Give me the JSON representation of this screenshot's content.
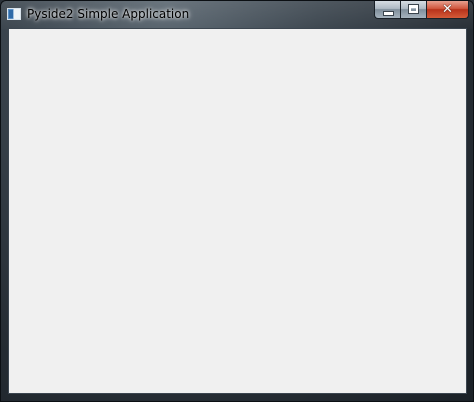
{
  "window": {
    "title": "Pyside2 Simple Application"
  },
  "titlebar": {
    "icons": {
      "app": "app-window-icon",
      "minimize": "minimize-icon",
      "maximize": "maximize-icon",
      "close": "close-icon"
    },
    "close_glyph": "✕"
  },
  "colors": {
    "client_background": "#f0f0f0",
    "frame": "#2a3138",
    "close_button": "#c8432a"
  }
}
